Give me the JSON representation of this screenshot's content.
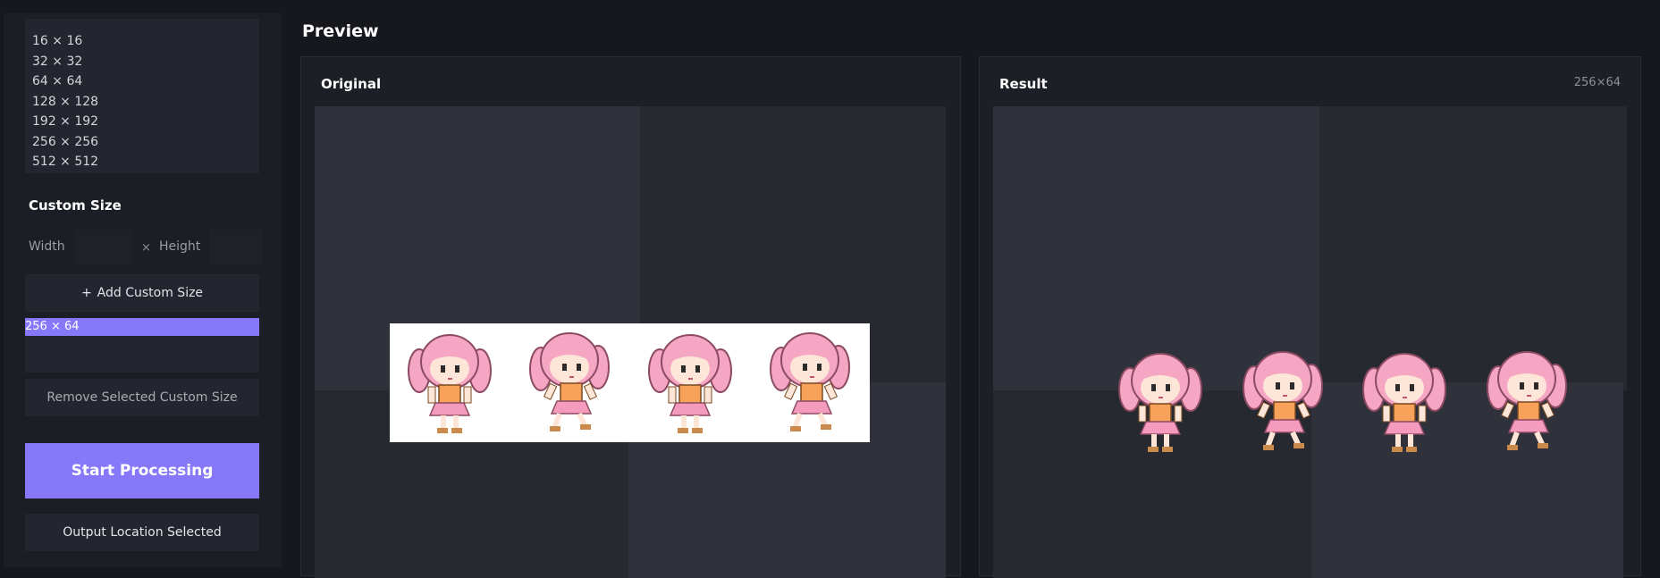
{
  "sidebar": {
    "preset_sizes": [
      "16 × 16",
      "32 × 32",
      "64 × 64",
      "128 × 128",
      "192 × 192",
      "256 × 256",
      "512 × 512"
    ],
    "custom_size": {
      "title": "Custom Size",
      "width_label": "Width",
      "height_label": "Height",
      "width_value": "",
      "height_value": "",
      "times": "×"
    },
    "add_button": {
      "icon": "+",
      "label": "Add Custom Size"
    },
    "custom_sizes": [
      "256 × 64"
    ],
    "remove_button": "Remove Selected Custom Size",
    "start_button": "Start Processing",
    "output_button": "Output Location Selected"
  },
  "preview": {
    "title": "Preview",
    "original": {
      "title": "Original"
    },
    "result": {
      "title": "Result",
      "dimensions": "256×64"
    }
  },
  "colors": {
    "accent": "#8678f8",
    "background": "#16181e",
    "panel": "#1d1f26",
    "hair": "#f4a6c2",
    "dress": "#f7a15a",
    "skirt": "#f59bbd"
  }
}
